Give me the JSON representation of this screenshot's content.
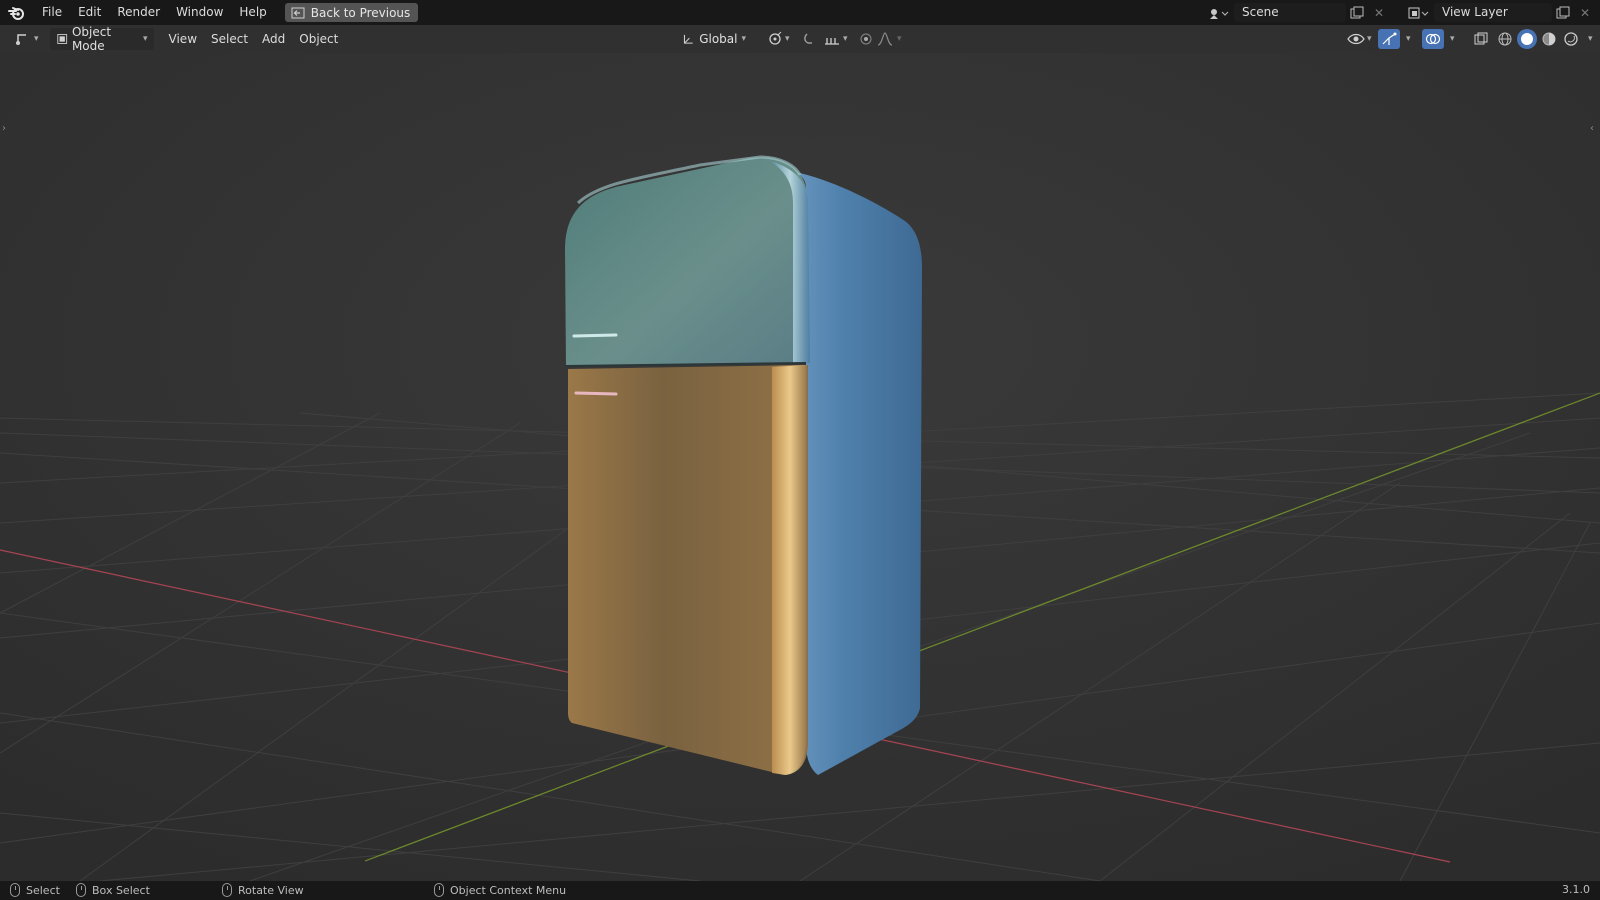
{
  "menu": {
    "items": [
      "File",
      "Edit",
      "Render",
      "Window",
      "Help"
    ],
    "back_button": "Back to Previous"
  },
  "scene": {
    "name": "Scene"
  },
  "view_layer": {
    "name": "View Layer"
  },
  "header": {
    "mode": "Object Mode",
    "menus": [
      "View",
      "Select",
      "Add",
      "Object"
    ],
    "transform_orientation": "Global"
  },
  "statusbar": {
    "select": "Select",
    "box_select": "Box Select",
    "rotate_view": "Rotate View",
    "context_menu": "Object Context Menu",
    "version": "3.1.0"
  },
  "colors": {
    "background": "#303030",
    "topbar": "#181818",
    "x_axis": "#a84452",
    "y_axis": "#6e8a2c",
    "fridge_top": "#5f8c8a",
    "fridge_bottom": "#8a6a42",
    "fridge_side": "#4a7aa6"
  },
  "icons": [
    "blender-logo-icon",
    "editor-type-icon",
    "object-mode-icon",
    "transform-orientation-icon",
    "pivot-icon",
    "snap-icon",
    "proportional-edit-icon",
    "visibility-icon",
    "gizmo-icon",
    "overlay-icon",
    "xray-icon",
    "shading-wireframe-icon",
    "shading-solid-icon",
    "shading-material-icon",
    "shading-rendered-icon"
  ]
}
